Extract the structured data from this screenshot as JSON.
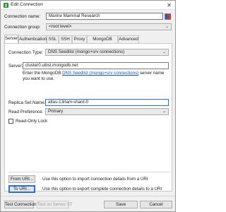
{
  "window": {
    "title": "Edit Connection",
    "close_glyph": "✕"
  },
  "connection": {
    "name_label": "Connection name:",
    "name_value": "Marine Mammal Research",
    "group_label": "Connection group:",
    "group_value": "<root level>"
  },
  "tabs": [
    {
      "label": "Server",
      "active": true
    },
    {
      "label": "Authentication",
      "active": false
    },
    {
      "label": "SSL",
      "active": false
    },
    {
      "label": "SSH",
      "active": false
    },
    {
      "label": "Proxy",
      "active": false
    },
    {
      "label": "MongoDB Tools",
      "active": false
    },
    {
      "label": "Advanced",
      "active": false
    }
  ],
  "server": {
    "type_label": "Connection Type:",
    "type_value": "DNS Seedlist (mongo+srv connections)",
    "server_label": "Server:",
    "server_value": "cluster0.uibst.mongodb.net",
    "hint_before": "Enter the MongoDB ",
    "hint_link": "DNS Seedlist (mongo+srv connections)",
    "hint_after": " server name you want to use.",
    "replica_label": "Replica Set Name:",
    "replica_value": "atlas-13rlam-shard-0",
    "read_pref_label": "Read Preference:",
    "read_pref_value": "Primary",
    "readonly_label": "Read-Only Lock"
  },
  "uri": {
    "from_label": "From URI...",
    "from_desc": "Use this option to import connection details from a URI",
    "to_label": "To URI...",
    "to_desc": "Use this option to export complete connection details to a URI"
  },
  "footer": {
    "test_label": "Test Connection",
    "test_st_label": "Test on Server ST",
    "save_label": "Save",
    "cancel_label": "Cancel"
  },
  "colors": {
    "accent": "#2c6fd6",
    "link": "#0b57c2",
    "app_icon": "#2e8b3e"
  }
}
